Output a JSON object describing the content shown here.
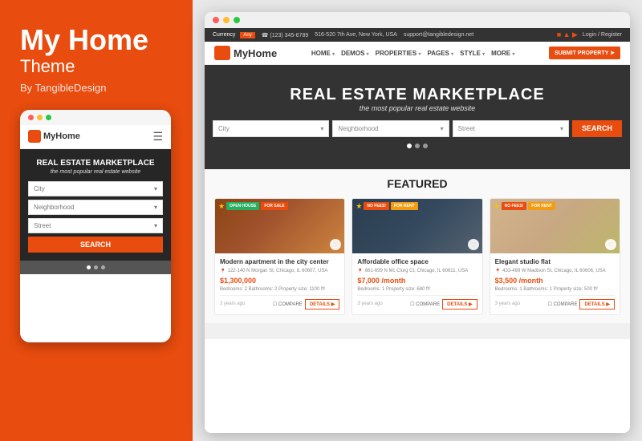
{
  "leftPanel": {
    "mainTitle": "My Home",
    "subTitle": "Theme",
    "byLine": "By TangibleDesign"
  },
  "mobileMockup": {
    "logo": "MyHome",
    "heroTitle": "REAL ESTATE MARKETPLACE",
    "heroSub": "the most popular real estate website",
    "selects": [
      "City",
      "Neighborhood",
      "Street"
    ],
    "searchBtn": "SEARCH"
  },
  "desktopMockup": {
    "utilityBar": {
      "currency": "Currency",
      "any": "Any",
      "phone1": "☎ (123) 345-6789",
      "address": "516-520 7th Ave, New York, USA",
      "email": "support@tangibledesign.net",
      "loginRegister": "Login / Register"
    },
    "navbar": {
      "logo": "MyHome",
      "links": [
        "HOME",
        "DEMOS",
        "PROPERTIES",
        "PAGES",
        "STYLE",
        "MORE"
      ],
      "submitProperty": "SUBMIT PROPERTY ➤"
    },
    "hero": {
      "title": "REAL ESTATE MARKETPLACE",
      "subtitle": "the most popular real estate website",
      "selects": [
        "City",
        "Neighborhood",
        "Street"
      ],
      "searchBtn": "SEARCH"
    },
    "featured": {
      "title": "FEATURED",
      "cards": [
        {
          "badges": [
            "OPEN HOUSE",
            "FOR SALE"
          ],
          "title": "Modern apartment in the city center",
          "address": "122-140 N Morgan St, Chicago, IL 60607, USA",
          "price": "$1,300,000",
          "details": "Bedrooms: 2  Bathrooms: 2  Property size: 1100 ft²",
          "age": "3 years ago"
        },
        {
          "badges": [
            "NO FEES!",
            "FOR RENT"
          ],
          "title": "Affordable office space",
          "address": "661-699 N Mc Clurg Ct, Chicago, IL 60611, USA",
          "price": "$7,000 /month",
          "details": "Bedrooms: 1  Property size: 680 ft²",
          "age": "3 years ago"
        },
        {
          "badges": [
            "NO FEES!",
            "FOR RENT"
          ],
          "title": "Elegant studio flat",
          "address": "433-499 W Madison St, Chicago, IL 60606, USA",
          "price": "$3,500 /month",
          "details": "Bedrooms: 1  Bathrooms: 1  Property size: 500 ft²",
          "age": "3 years ago"
        }
      ]
    }
  }
}
